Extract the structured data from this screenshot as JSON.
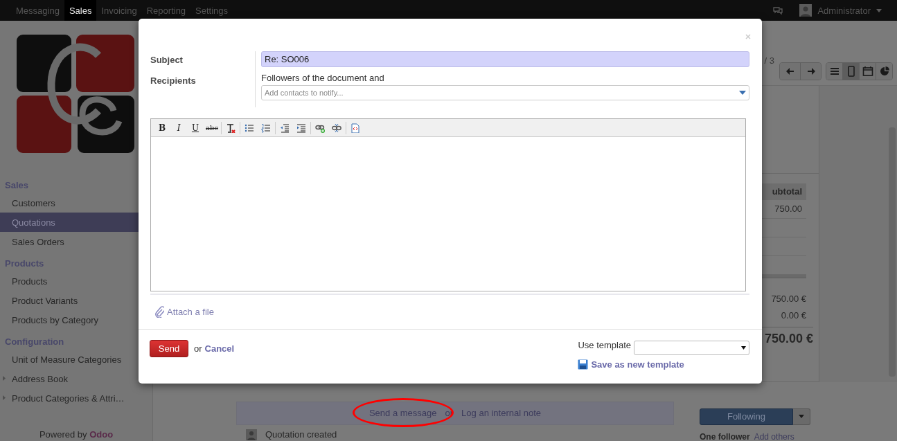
{
  "top_menu": [
    {
      "label": "Messaging",
      "selected": false
    },
    {
      "label": "Sales",
      "selected": true
    },
    {
      "label": "Invoicing",
      "selected": false
    },
    {
      "label": "Reporting",
      "selected": false
    },
    {
      "label": "Settings",
      "selected": false
    }
  ],
  "user": {
    "name": "Administrator"
  },
  "sidebar": {
    "sections": [
      {
        "title": "Sales",
        "items": [
          {
            "label": "Customers",
            "selected": false,
            "expandable": false
          },
          {
            "label": "Quotations",
            "selected": true,
            "expandable": false
          },
          {
            "label": "Sales Orders",
            "selected": false,
            "expandable": false
          }
        ]
      },
      {
        "title": "Products",
        "items": [
          {
            "label": "Products",
            "selected": false,
            "expandable": false
          },
          {
            "label": "Product Variants",
            "selected": false,
            "expandable": false
          },
          {
            "label": "Products by Category",
            "selected": false,
            "expandable": false
          }
        ]
      },
      {
        "title": "Configuration",
        "items": [
          {
            "label": "Unit of Measure Categories",
            "selected": false,
            "expandable": false
          },
          {
            "label": "Address Book",
            "selected": false,
            "expandable": true
          },
          {
            "label": "Product Categories & Attri…",
            "selected": false,
            "expandable": true
          }
        ]
      }
    ],
    "footer_text": "Powered by",
    "footer_brand": "Odoo"
  },
  "record": {
    "pager": "/ 3",
    "views": [
      {
        "kind": "list",
        "selected": false
      },
      {
        "kind": "form",
        "selected": true
      },
      {
        "kind": "calendar",
        "selected": false
      },
      {
        "kind": "graph",
        "selected": false
      }
    ],
    "lines_header": "ubtotal",
    "line_subtotal": "750.00",
    "untaxed": "750.00 €",
    "taxes": "0.00 €",
    "total": "750.00 €"
  },
  "chatter": {
    "send_message": "Send a message",
    "or": "or",
    "log_note": "Log an internal note",
    "follow_button": "Following",
    "message": "Quotation created",
    "followers": "One follower",
    "add_followers": "Add others"
  },
  "dialog": {
    "subject_label": "Subject",
    "subject": "Re: SO006",
    "recipients_label": "Recipients",
    "recipients_text": "Followers of the document and",
    "contacts_placeholder": "Add contacts to notify...",
    "toolbar": [
      {
        "kind": "bold",
        "glyph": "B"
      },
      {
        "kind": "italic",
        "glyph": "I"
      },
      {
        "kind": "underline",
        "glyph": "U"
      },
      {
        "kind": "strike",
        "glyph": "abc"
      },
      {
        "kind": "clear-format"
      },
      {
        "kind": "bullet-list"
      },
      {
        "kind": "number-list"
      },
      {
        "kind": "outdent"
      },
      {
        "kind": "indent"
      },
      {
        "kind": "link"
      },
      {
        "kind": "unlink"
      },
      {
        "kind": "source"
      }
    ],
    "attach": "Attach a file",
    "send": "Send",
    "or": "or",
    "cancel": "Cancel",
    "template_label": "Use template",
    "save_template": "Save as new template"
  }
}
